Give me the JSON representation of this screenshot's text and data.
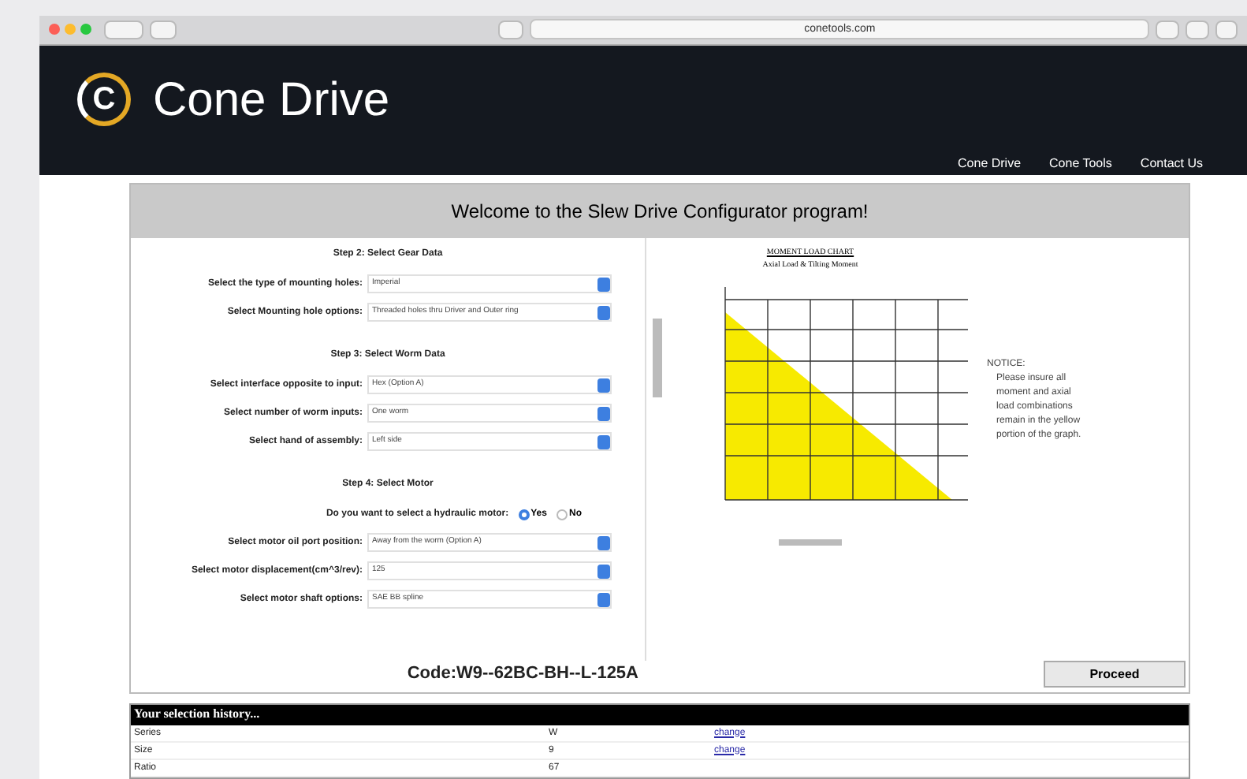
{
  "browser": {
    "url": "conetools.com"
  },
  "header": {
    "logo_mark": "C",
    "brand": "Cone Drive",
    "nav": [
      {
        "label": "Cone Drive"
      },
      {
        "label": "Cone Tools"
      },
      {
        "label": "Contact Us"
      }
    ]
  },
  "panel_title": "Welcome to the Slew Drive Configurator program!",
  "steps": [
    {
      "title": "Step 2: Select Gear Data",
      "fields": [
        {
          "kind": "select",
          "label": "Select the type of mounting holes:",
          "value": "Imperial"
        },
        {
          "kind": "select",
          "label": "Select Mounting hole options:",
          "value": "Threaded holes thru Driver and Outer ring"
        }
      ]
    },
    {
      "title": "Step 3: Select Worm Data",
      "fields": [
        {
          "kind": "select",
          "label": "Select interface opposite to input:",
          "value": "Hex (Option A)"
        },
        {
          "kind": "select",
          "label": "Select number of worm inputs:",
          "value": "One worm"
        },
        {
          "kind": "select",
          "label": "Select hand of assembly:",
          "value": "Left side"
        }
      ]
    },
    {
      "title": "Step 4: Select Motor",
      "fields": [
        {
          "kind": "radio",
          "label": "Do you want to select a hydraulic motor:",
          "options": [
            {
              "label": "Yes",
              "selected": true
            },
            {
              "label": "No",
              "selected": false
            }
          ]
        },
        {
          "kind": "select",
          "label": "Select motor oil port position:",
          "value": "Away from the worm (Option A)"
        },
        {
          "kind": "select",
          "label": "Select motor displacement(cm^3/rev):",
          "value": "125"
        },
        {
          "kind": "select",
          "label": "Select motor shaft options:",
          "value": "SAE BB spline"
        }
      ]
    }
  ],
  "chart": {
    "title": "MOMENT LOAD CHART",
    "subtitle": "Axial Load & Tilting Moment"
  },
  "notice": {
    "heading": "NOTICE:",
    "text": "Please insure all moment and axial load combinations remain in the yellow portion of the graph."
  },
  "code": "Code:W9--62BC-BH--L-125A",
  "proceed": "Proceed",
  "history": {
    "title": "Your selection history...",
    "rows": [
      {
        "name": "Series",
        "value": "W",
        "link": "change"
      },
      {
        "name": "Size",
        "value": "9",
        "link": "change"
      },
      {
        "name": "Ratio",
        "value": "67"
      }
    ]
  }
}
